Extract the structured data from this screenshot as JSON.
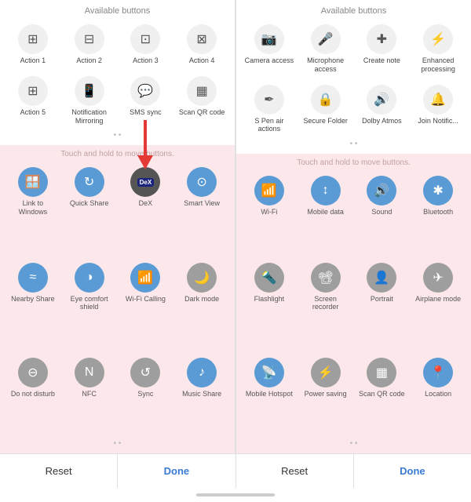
{
  "left": {
    "section_title": "Available buttons",
    "available_buttons": [
      {
        "label": "Action 1",
        "icon": "⊞"
      },
      {
        "label": "Action 2",
        "icon": "⊟"
      },
      {
        "label": "Action 3",
        "icon": "⊡"
      },
      {
        "label": "Action 4",
        "icon": "⊠"
      },
      {
        "label": "Action 5",
        "icon": "⊞"
      },
      {
        "label": "Notification Mirroring",
        "icon": "📱"
      },
      {
        "label": "SMS sync",
        "icon": "💬"
      },
      {
        "label": "Scan QR code",
        "icon": "▦"
      }
    ],
    "active_title": "Touch and hold to move buttons.",
    "active_buttons": [
      {
        "label": "Link to Windows",
        "icon": "🪟",
        "color": "icon-blue"
      },
      {
        "label": "Quick Share",
        "icon": "↻",
        "color": "icon-blue"
      },
      {
        "label": "DeX",
        "icon": "DeX",
        "color": "icon-dark",
        "is_dex": true
      },
      {
        "label": "Smart View",
        "icon": "⊙",
        "color": "icon-blue"
      },
      {
        "label": "Nearby Share",
        "icon": "≈",
        "color": "icon-blue"
      },
      {
        "label": "Eye comfort shield",
        "icon": "◑",
        "color": "icon-blue"
      },
      {
        "label": "Wi-Fi Calling",
        "icon": "📶",
        "color": "icon-blue"
      },
      {
        "label": "Dark mode",
        "icon": "🌙",
        "color": "icon-gray"
      },
      {
        "label": "Do not disturb",
        "icon": "⊖",
        "color": "icon-gray"
      },
      {
        "label": "NFC",
        "icon": "N",
        "color": "icon-gray"
      },
      {
        "label": "Sync",
        "icon": "↺",
        "color": "icon-gray"
      },
      {
        "label": "Music Share",
        "icon": "♪",
        "color": "icon-blue"
      }
    ]
  },
  "right": {
    "section_title": "Available buttons",
    "available_buttons": [
      {
        "label": "Camera access",
        "icon": "📷"
      },
      {
        "label": "Microphone access",
        "icon": "🎤"
      },
      {
        "label": "Create note",
        "icon": "✚"
      },
      {
        "label": "Enhanced processing",
        "icon": "⚡"
      },
      {
        "label": "S Pen air actions",
        "icon": "✒"
      },
      {
        "label": "Secure Folder",
        "icon": "🔒"
      },
      {
        "label": "Dolby Atmos",
        "icon": "🔊"
      },
      {
        "label": "Join Notific...",
        "icon": "🔔"
      }
    ],
    "active_title": "Touch and hold to move buttons.",
    "active_buttons": [
      {
        "label": "Wi-Fi",
        "icon": "📶",
        "color": "icon-blue"
      },
      {
        "label": "Mobile data",
        "icon": "↕",
        "color": "icon-blue"
      },
      {
        "label": "Sound",
        "icon": "🔊",
        "color": "icon-blue"
      },
      {
        "label": "Bluetooth",
        "icon": "✱",
        "color": "icon-blue"
      },
      {
        "label": "Flashlight",
        "icon": "🔦",
        "color": "icon-gray"
      },
      {
        "label": "Screen recorder",
        "icon": "📽",
        "color": "icon-gray"
      },
      {
        "label": "Portrait",
        "icon": "👤",
        "color": "icon-gray"
      },
      {
        "label": "Airplane mode",
        "icon": "✈",
        "color": "icon-gray"
      },
      {
        "label": "Mobile Hotspot",
        "icon": "📡",
        "color": "icon-blue"
      },
      {
        "label": "Power saving",
        "icon": "⚡",
        "color": "icon-gray"
      },
      {
        "label": "Scan QR code",
        "icon": "▦",
        "color": "icon-gray"
      },
      {
        "label": "Location",
        "icon": "📍",
        "color": "icon-blue"
      }
    ]
  },
  "footer": {
    "reset_label": "Reset",
    "done_label": "Done"
  }
}
